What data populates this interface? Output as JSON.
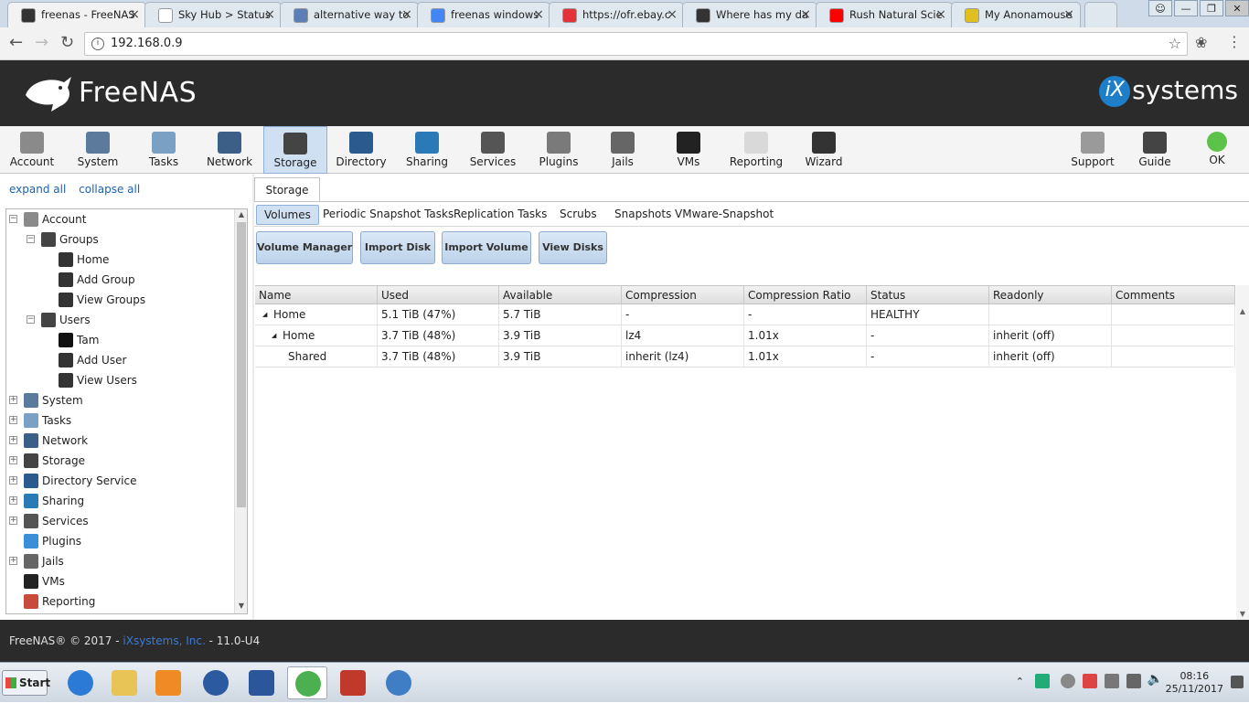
{
  "browser": {
    "tabs": [
      {
        "title": "freenas - FreeNAS",
        "favicon_color": "#333333",
        "favicon": "freenas-icon"
      },
      {
        "title": "Sky Hub > Status",
        "favicon_color": "#ffffff",
        "favicon": "page-icon"
      },
      {
        "title": "alternative way to",
        "favicon_color": "#5b7fb5",
        "favicon": "tn-icon"
      },
      {
        "title": "freenas windows",
        "favicon_color": "#4285f4",
        "favicon": "google-icon"
      },
      {
        "title": "https://ofr.ebay.c",
        "favicon_color": "#e53238",
        "favicon": "ebay-icon"
      },
      {
        "title": "Where has my da",
        "favicon_color": "#333333",
        "favicon": "freenas-icon"
      },
      {
        "title": "Rush Natural Scie",
        "favicon_color": "#ff0000",
        "favicon": "youtube-icon"
      },
      {
        "title": "My Anonamouse",
        "favicon_color": "#e0c020",
        "favicon": "mouse-icon"
      }
    ],
    "url": "192.168.0.9"
  },
  "header": {
    "product_name": "FreeNAS",
    "vendor_badge": "iX",
    "vendor_name": "systems"
  },
  "toolbar": {
    "items": [
      {
        "label": "Account",
        "icon": "account-icon",
        "color": "#8a8a8a"
      },
      {
        "label": "System",
        "icon": "system-icon",
        "color": "#5c7a9c"
      },
      {
        "label": "Tasks",
        "icon": "tasks-icon",
        "color": "#7aa0c4"
      },
      {
        "label": "Network",
        "icon": "network-icon",
        "color": "#3b5f86"
      },
      {
        "label": "Storage",
        "icon": "storage-icon",
        "color": "#444444"
      },
      {
        "label": "Directory",
        "icon": "directory-icon",
        "color": "#2b5a8e"
      },
      {
        "label": "Sharing",
        "icon": "sharing-icon",
        "color": "#2a7ab8"
      },
      {
        "label": "Services",
        "icon": "services-icon",
        "color": "#555555"
      },
      {
        "label": "Plugins",
        "icon": "plugins-icon",
        "color": "#7a7a7a"
      },
      {
        "label": "Jails",
        "icon": "jails-icon",
        "color": "#666666"
      },
      {
        "label": "VMs",
        "icon": "vms-icon",
        "color": "#222222"
      },
      {
        "label": "Reporting",
        "icon": "reporting-icon",
        "color": "#d9d9d9"
      },
      {
        "label": "Wizard",
        "icon": "wizard-icon",
        "color": "#333333"
      },
      {
        "label": "Support",
        "icon": "support-icon",
        "color": "#9a9a9a"
      },
      {
        "label": "Guide",
        "icon": "guide-icon",
        "color": "#444444"
      },
      {
        "label": "OK",
        "icon": "status-ok-icon",
        "color": "#5cc24a"
      }
    ],
    "active": "Storage"
  },
  "sidebar": {
    "expand_all": "expand all",
    "collapse_all": "collapse all",
    "tree": [
      {
        "label": "Account",
        "toggle": "−",
        "icon": "account-icon",
        "color": "#8a8a8a"
      },
      {
        "label": "Groups",
        "toggle": "−",
        "icon": "groups-icon",
        "color": "#444444"
      },
      {
        "label": "Home",
        "toggle": "",
        "icon": "group-icon",
        "color": "#333333"
      },
      {
        "label": "Add Group",
        "toggle": "",
        "icon": "add-group-icon",
        "color": "#333333"
      },
      {
        "label": "View Groups",
        "toggle": "",
        "icon": "view-groups-icon",
        "color": "#333333"
      },
      {
        "label": "Users",
        "toggle": "−",
        "icon": "users-icon",
        "color": "#444444"
      },
      {
        "label": "Tam",
        "toggle": "",
        "icon": "user-icon",
        "color": "#111111"
      },
      {
        "label": "Add User",
        "toggle": "",
        "icon": "add-user-icon",
        "color": "#333333"
      },
      {
        "label": "View Users",
        "toggle": "",
        "icon": "view-users-icon",
        "color": "#333333"
      },
      {
        "label": "System",
        "toggle": "+",
        "icon": "system-icon",
        "color": "#5c7a9c"
      },
      {
        "label": "Tasks",
        "toggle": "+",
        "icon": "tasks-icon",
        "color": "#7aa0c4"
      },
      {
        "label": "Network",
        "toggle": "+",
        "icon": "network-icon",
        "color": "#3b5f86"
      },
      {
        "label": "Storage",
        "toggle": "+",
        "icon": "storage-icon",
        "color": "#444444"
      },
      {
        "label": "Directory Service",
        "toggle": "+",
        "icon": "directory-icon",
        "color": "#2b5a8e"
      },
      {
        "label": "Sharing",
        "toggle": "+",
        "icon": "sharing-icon",
        "color": "#2a7ab8"
      },
      {
        "label": "Services",
        "toggle": "+",
        "icon": "services-icon",
        "color": "#555555"
      },
      {
        "label": "Plugins",
        "toggle": "",
        "icon": "plugins-icon",
        "color": "#3a8fd6"
      },
      {
        "label": "Jails",
        "toggle": "+",
        "icon": "jails-icon",
        "color": "#666666"
      },
      {
        "label": "VMs",
        "toggle": "",
        "icon": "vms-icon",
        "color": "#222222"
      },
      {
        "label": "Reporting",
        "toggle": "",
        "icon": "reporting-icon",
        "color": "#c94a3a"
      }
    ]
  },
  "main": {
    "tab": "Storage",
    "subtabs": [
      "Volumes",
      "Periodic Snapshot Tasks",
      "Replication Tasks",
      "Scrubs",
      "Snapshots",
      "VMware-Snapshot"
    ],
    "active_subtab": "Volumes",
    "buttons": [
      "Volume Manager",
      "Import Disk",
      "Import Volume",
      "View Disks"
    ],
    "table": {
      "columns": [
        "Name",
        "Used",
        "Available",
        "Compression",
        "Compression Ratio",
        "Status",
        "Readonly",
        "Comments"
      ],
      "rows": [
        {
          "name": "Home",
          "arrow": "◢",
          "cells": [
            "5.1 TiB (47%)",
            "5.7 TiB",
            "-",
            "-",
            "HEALTHY",
            "",
            ""
          ]
        },
        {
          "name": "Home",
          "arrow": "◢",
          "cells": [
            "3.7 TiB (48%)",
            "3.9 TiB",
            "lz4",
            "1.01x",
            "-",
            "inherit (off)",
            ""
          ]
        },
        {
          "name": "Shared",
          "arrow": "",
          "cells": [
            "3.7 TiB (48%)",
            "3.9 TiB",
            "inherit (lz4)",
            "1.01x",
            "-",
            "inherit (off)",
            ""
          ]
        }
      ]
    }
  },
  "footer": {
    "prefix": "FreeNAS® © 2017 - ",
    "link": "iXsystems, Inc.",
    "suffix": " - 11.0-U4"
  },
  "taskbar": {
    "start": "Start",
    "apps": [
      {
        "name": "ie-icon",
        "color": "#2b7bd6"
      },
      {
        "name": "explorer-icon",
        "color": "#e8c356"
      },
      {
        "name": "media-player-icon",
        "color": "#f08a24"
      },
      {
        "name": "thunderbird-icon",
        "color": "#2c5aa0"
      },
      {
        "name": "word-icon",
        "color": "#2b579a"
      },
      {
        "name": "chrome-icon",
        "color": "#4caf50"
      },
      {
        "name": "toolbox-icon",
        "color": "#c0392b"
      },
      {
        "name": "qbittorrent-icon",
        "color": "#3f7dc4"
      }
    ],
    "time": "08:16",
    "date": "25/11/2017"
  }
}
